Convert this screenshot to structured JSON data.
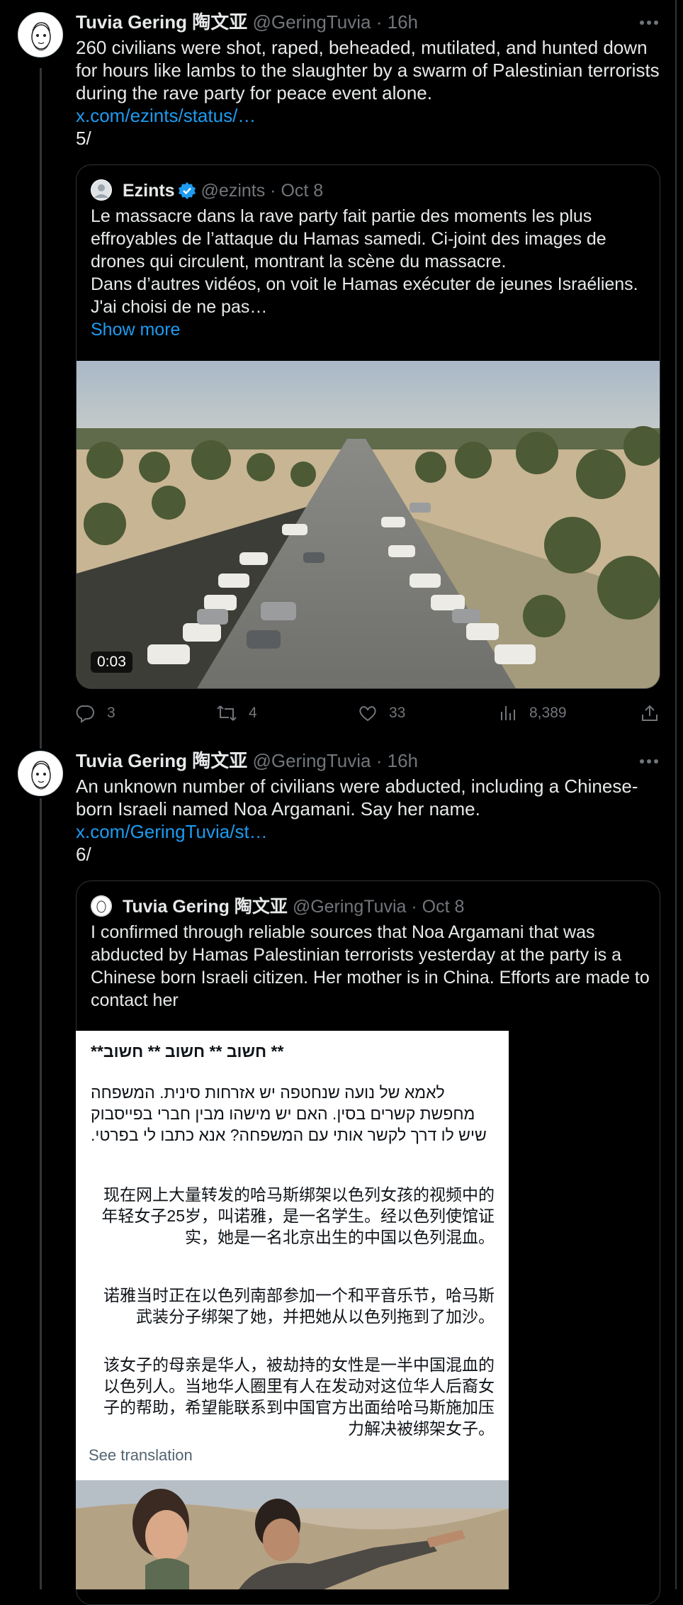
{
  "tweets": [
    {
      "author_name": "Tuvia Gering 陶文亚",
      "author_handle": "@GeringTuvia",
      "time": "16h",
      "text": "260 civilians were shot, raped, beheaded, mutilated, and hunted down for hours like lambs to the slaughter by a swarm of Palestinian terrorists during the rave party for peace event alone.",
      "link": "x.com/ezints/status/…",
      "thread_index": "5/",
      "quote": {
        "author_name": "Ezints",
        "author_handle": "@ezints",
        "time": "Oct 8",
        "text": "Le massacre dans la rave party fait partie des moments les plus effroyables de l’attaque du Hamas samedi. Ci-joint des images de drones qui circulent, montrant la scène du massacre.\nDans d’autres vidéos, on voit le Hamas exécuter de jeunes Israéliens. J'ai choisi de ne pas…",
        "show_more": "Show more",
        "video_duration": "0:03"
      },
      "actions": {
        "replies": "3",
        "reposts": "4",
        "likes": "33",
        "views": "8,389"
      }
    },
    {
      "author_name": "Tuvia Gering 陶文亚",
      "author_handle": "@GeringTuvia",
      "time": "16h",
      "text": "An unknown number of civilians were abducted, including a Chinese-born Israeli named Noa Argamani. Say her name.",
      "link": "x.com/GeringTuvia/st…",
      "thread_index": "6/",
      "quote": {
        "author_name": "Tuvia Gering 陶文亚",
        "author_handle": "@GeringTuvia",
        "time": "Oct 8",
        "text": "I confirmed through reliable sources that Noa Argamani that was abducted by Hamas Palestinian terrorists yesterday at the party is a Chinese born Israeli citizen. Her mother is in China. Efforts are made to contact her",
        "document": {
          "heading": "** חשוב ** חשוב ** חשוב**",
          "hebrew": "לאמא של נועה שנחטפה יש אזרחות סינית. המשפחה מחפשת קשרים בסין. האם יש מישהו מבין חברי בפייסבוק שיש לו דרך לקשר אותי עם המשפחה? אנא כתבו לי בפרטי.",
          "zh_1": "现在网上大量转发的哈马斯绑架以色列女孩的视频中的年轻女子25岁，叫诺雅，是一名学生。经以色列使馆证实，她是一名北京出生的中国以色列混血。",
          "zh_2": "诺雅当时正在以色列南部参加一个和平音乐节，哈马斯武装分子绑架了她，并把她从以色列拖到了加沙。",
          "zh_3": "该女子的母亲是华人，被劫持的女性是一半中国混血的以色列人。当地华人圈里有人在发动对这位华人后裔女子的帮助，希望能联系到中国官方出面给哈马斯施加压力解决被绑架女子。",
          "see_translation": "See translation"
        }
      }
    }
  ],
  "colors": {
    "link": "#1d9bf0",
    "muted": "#71767b",
    "border": "#2f3336",
    "verified": "#1d9bf0"
  }
}
